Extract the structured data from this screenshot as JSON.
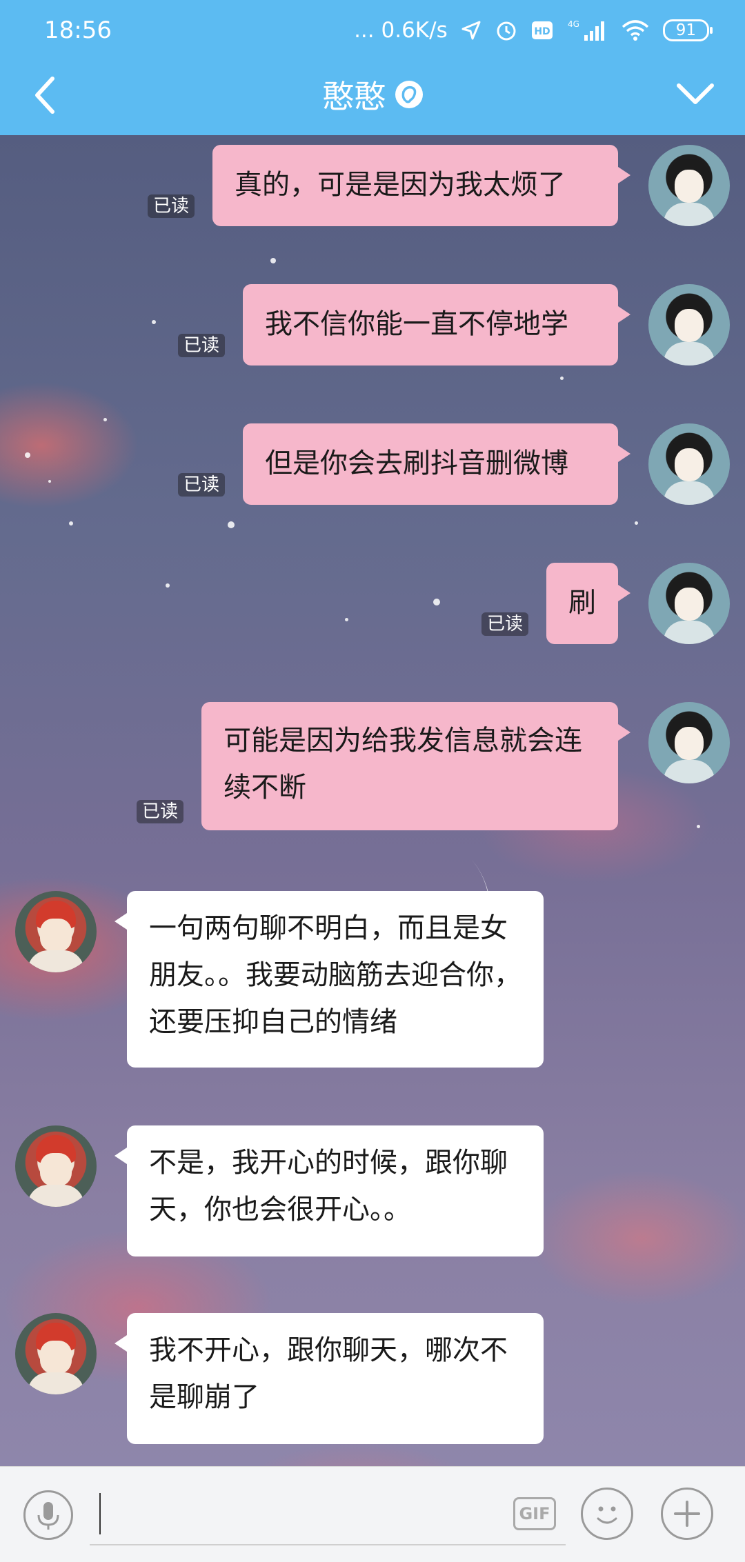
{
  "status_bar": {
    "time": "18:56",
    "network_speed": "... 0.6K/s",
    "network_type": "4G",
    "battery": "91",
    "hd_label": "HD"
  },
  "header": {
    "title": "憨憨",
    "back_icon": "chevron-left-icon",
    "more_icon": "chevron-down-icon"
  },
  "messages": [
    {
      "from": "me",
      "text": "真的，可是是因为我太烦了",
      "read": "已读"
    },
    {
      "from": "me",
      "text": "我不信你能一直不停地学",
      "read": "已读"
    },
    {
      "from": "me",
      "text": "但是你会去刷抖音删微博",
      "read": "已读"
    },
    {
      "from": "me",
      "text": "刷",
      "read": "已读"
    },
    {
      "from": "me",
      "text": "可能是因为给我发信息就会连续不断",
      "read": "已读"
    },
    {
      "from": "other",
      "text": "一句两句聊不明白，而且是女朋友。。我要动脑筋去迎合你，还要压抑自己的情绪"
    },
    {
      "from": "other",
      "text": "不是，我开心的时候，跟你聊天，你也会很开心。。"
    },
    {
      "from": "other",
      "text": "我不开心，跟你聊天，哪次不是聊崩了"
    }
  ],
  "input_bar": {
    "placeholder": "",
    "gif_label": "GIF"
  },
  "colors": {
    "header_bg": "#5cbbf2",
    "sent_bubble": "#f6b7cb",
    "recv_bubble": "#ffffff"
  }
}
